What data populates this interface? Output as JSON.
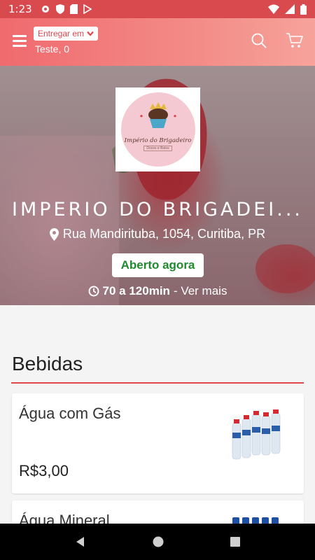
{
  "status_bar": {
    "time": "1:23"
  },
  "header": {
    "deliver_label": "Entregar em",
    "address": "Teste, 0"
  },
  "store": {
    "logo_name": "Império do Brigadeiro",
    "logo_subtitle": "Doces e Bolos",
    "name": "IMPERIO DO BRIGADEI...",
    "address": "Rua Mandirituba, 1054, Curitiba, PR",
    "status": "Aberto agora",
    "delivery_time": "70 a 120min",
    "see_more": "- Ver mais"
  },
  "menu": {
    "category": "Bebidas",
    "items": [
      {
        "name": "Água com Gás",
        "price": "R$3,00"
      },
      {
        "name": "Água Mineral",
        "price": ""
      }
    ]
  },
  "colors": {
    "accent": "#e0474c",
    "open_green": "#1f8a2e"
  }
}
